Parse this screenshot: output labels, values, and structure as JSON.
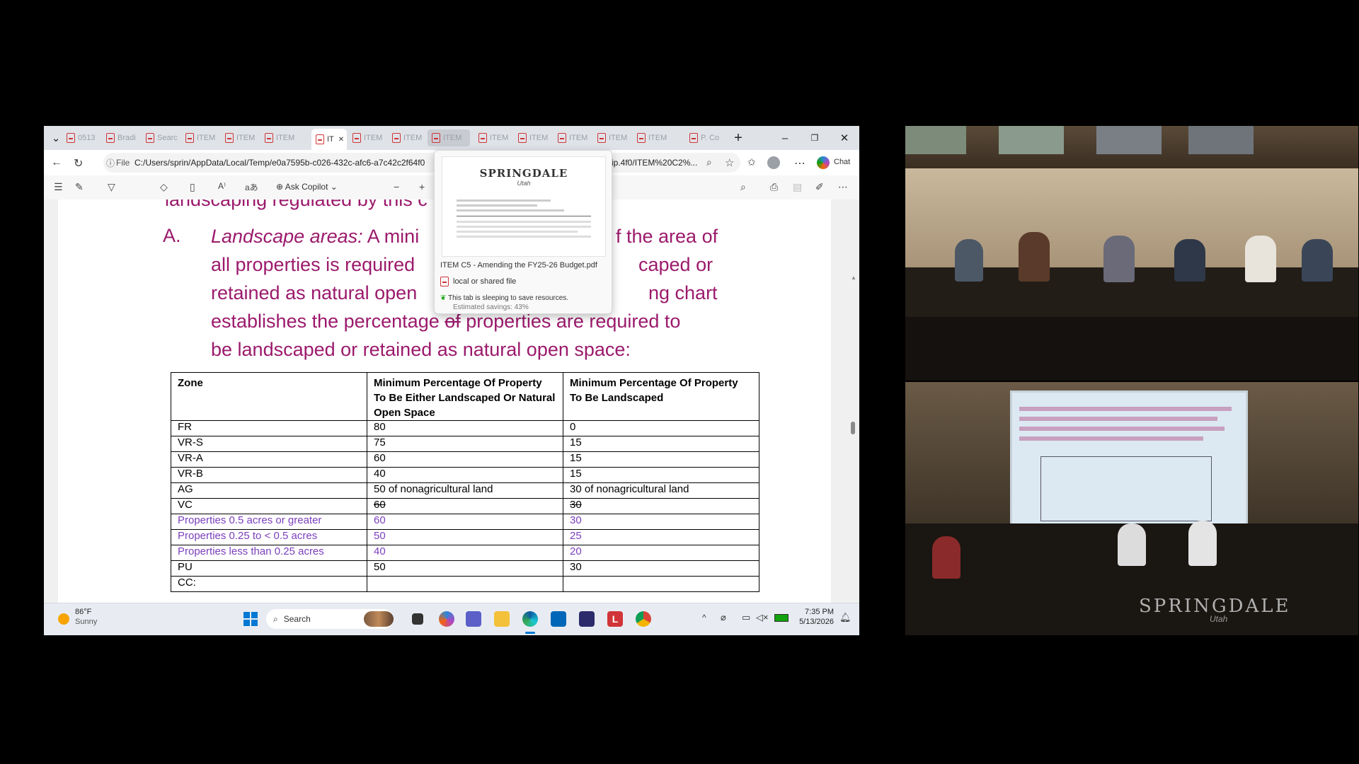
{
  "browser": {
    "tabs": [
      {
        "label": "0513",
        "state": "normal"
      },
      {
        "label": "Bradi",
        "state": "normal"
      },
      {
        "label": "Searc",
        "state": "normal"
      },
      {
        "label": "ITEM",
        "state": "normal"
      },
      {
        "label": "ITEM",
        "state": "normal"
      },
      {
        "label": "ITEM",
        "state": "normal"
      },
      {
        "label": "IT",
        "state": "active"
      },
      {
        "label": "ITEM",
        "state": "normal"
      },
      {
        "label": "ITEM",
        "state": "normal"
      },
      {
        "label": "ITEM",
        "state": "hover"
      },
      {
        "label": "ITEM",
        "state": "normal"
      },
      {
        "label": "ITEM",
        "state": "normal"
      },
      {
        "label": "ITEM",
        "state": "normal"
      },
      {
        "label": "ITEM",
        "state": "normal"
      },
      {
        "label": "ITEM",
        "state": "normal"
      },
      {
        "label": "P. Co",
        "state": "normal"
      }
    ],
    "file_label": "File",
    "url": "C:/Users/sprin/AppData/Local/Temp/e0a7595b-c026-432c-afc6-a7c42c2f64f0",
    "url_tail": "ip.4f0/ITEM%20C2%...",
    "chat_label": "Chat",
    "ask_copilot_label": "Ask Copilot",
    "zoom_minus": "−",
    "zoom_plus": "+"
  },
  "tab_preview": {
    "logo_text": "SPRINGDALE",
    "logo_sub": "Utah",
    "title": "ITEM C5 - Amending the FY25-26 Budget.pdf",
    "source": "local or shared file",
    "sleep_msg": "This tab is sleeping to save resources.",
    "savings": "Estimated savings: 43%"
  },
  "document": {
    "top_clipped": "landscaping regulated by this c",
    "section_label": "A.",
    "line1_italic": "Landscape areas:",
    "line1_rest": " A mini",
    "line1_right": "f the area of",
    "line2_left": "all properties is required",
    "line2_right": "caped or",
    "line3_left": "retained as natural open",
    "line3_right": "ng chart",
    "line4_a": "establishes the percentage ",
    "line4_strike": "of",
    "line4_b": " properties are required to",
    "line5": "be landscaped or retained as natural open space:",
    "table": {
      "headers": [
        "Zone",
        "Minimum Percentage Of Property To Be Either Landscaped Or Natural Open Space",
        "Minimum Percentage Of Property To Be Landscaped"
      ],
      "rows": [
        {
          "zone": " FR",
          "a": "80",
          "b": "0",
          "style": "normal"
        },
        {
          "zone": "VR-S",
          "a": "75",
          "b": "15",
          "style": "normal"
        },
        {
          "zone": "VR-A",
          "a": "60",
          "b": "15",
          "style": "normal"
        },
        {
          "zone": "VR-B",
          "a": "40",
          "b": "15",
          "style": "normal"
        },
        {
          "zone": "AG",
          "a": "50 of nonagricultural land",
          "b": "30 of nonagricultural land",
          "style": "normal"
        },
        {
          "zone": "VC",
          "a": "60",
          "b": "30",
          "style": "strike"
        },
        {
          "zone": "Properties 0.5 acres or greater",
          "a": "60",
          "b": "30",
          "style": "purple"
        },
        {
          "zone": "Properties 0.25 to < 0.5 acres",
          "a": "50",
          "b": "25",
          "style": "purple"
        },
        {
          "zone": "Properties less than 0.25 acres",
          "a": "40",
          "b": "20",
          "style": "purple"
        },
        {
          "zone": "PU",
          "a": "50",
          "b": "30",
          "style": "normal"
        },
        {
          "zone": "CC:",
          "a": "",
          "b": "",
          "style": "normal"
        }
      ]
    }
  },
  "taskbar": {
    "temp": "86°F",
    "weather": "Sunny",
    "search_placeholder": "Search",
    "time": "7:35 PM",
    "date": "5/13/2026"
  },
  "video": {
    "logo_text": "SPRINGDALE",
    "logo_sub": "Utah"
  },
  "colors": {
    "doc_text": "#9b1a6c",
    "added_text": "#7b3fbd",
    "pdf_icon": "#d13438"
  }
}
